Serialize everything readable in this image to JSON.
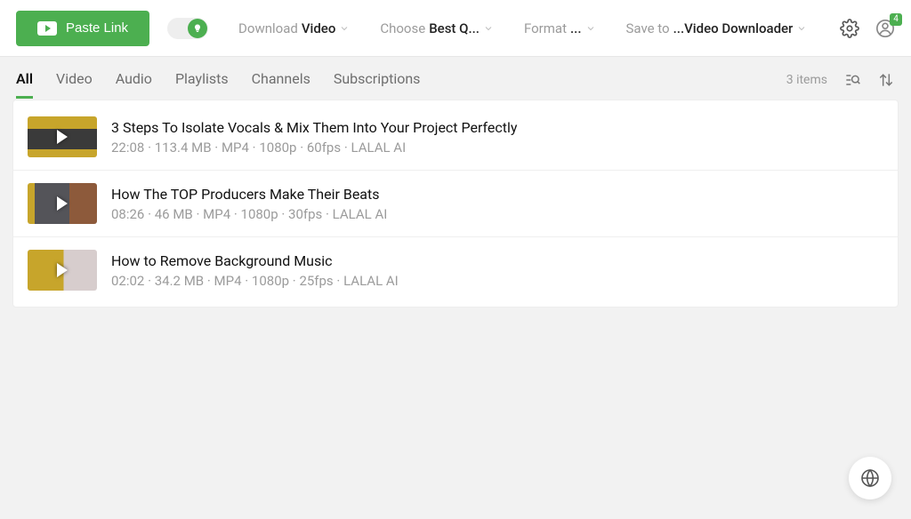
{
  "toolbar": {
    "paste_label": "Paste Link",
    "download_label": "Download",
    "download_value": "Video",
    "choose_label": "Choose",
    "choose_value": "Best Q...",
    "format_label": "Format",
    "format_value": "...",
    "saveto_label": "Save to",
    "saveto_value": "...Video Downloader",
    "badge_count": "4"
  },
  "tabs": [
    {
      "label": "All"
    },
    {
      "label": "Video"
    },
    {
      "label": "Audio"
    },
    {
      "label": "Playlists"
    },
    {
      "label": "Channels"
    },
    {
      "label": "Subscriptions"
    }
  ],
  "items_count_label": "3 items",
  "items": [
    {
      "title": "3 Steps To Isolate Vocals & Mix Them Into Your Project Perfectly",
      "duration": "22:08",
      "size": "113.4 MB",
      "format": "MP4",
      "res": "1080p",
      "fps": "60fps",
      "source": "LALAL AI"
    },
    {
      "title": "How The TOP Producers Make Their Beats",
      "duration": "08:26",
      "size": "46 MB",
      "format": "MP4",
      "res": "1080p",
      "fps": "30fps",
      "source": "LALAL AI"
    },
    {
      "title": "How to Remove Background Music",
      "duration": "02:02",
      "size": "34.2 MB",
      "format": "MP4",
      "res": "1080p",
      "fps": "25fps",
      "source": "LALAL AI"
    }
  ]
}
